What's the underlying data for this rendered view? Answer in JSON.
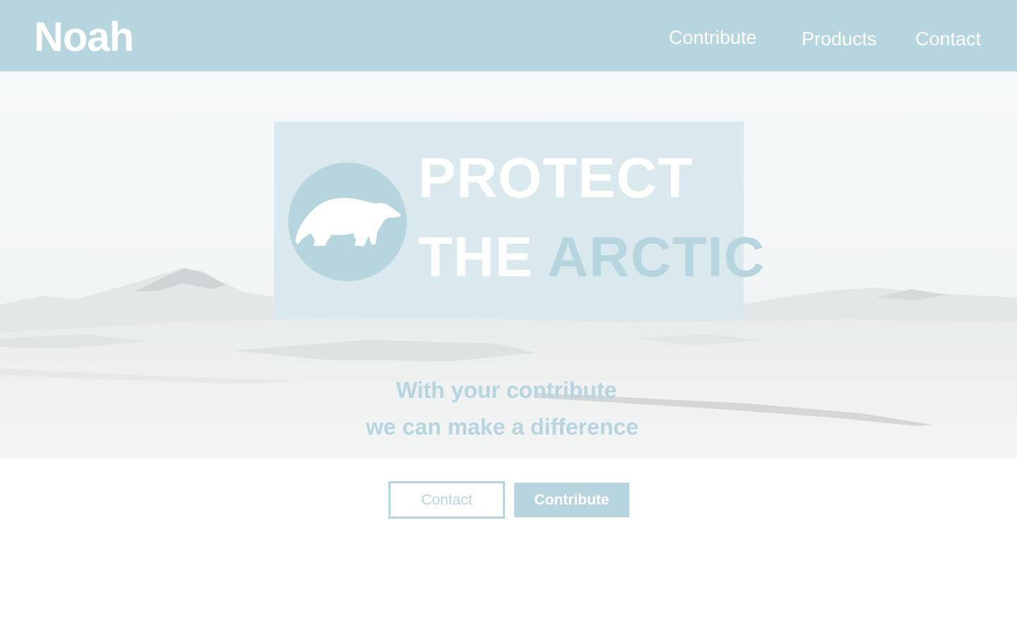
{
  "header": {
    "logo": "Noah",
    "nav": [
      {
        "label": "Contribute"
      },
      {
        "label": "Products"
      },
      {
        "label": "Contact"
      }
    ]
  },
  "hero": {
    "headline_line1": "PROTECT",
    "headline_line2_part1": "THE ",
    "headline_line2_part2": "ARCTIC",
    "logo_icon": "polar-bear-icon",
    "tagline_line1": "With your contribute",
    "tagline_line2": "we can make a difference"
  },
  "actions": {
    "contact_label": "Contact",
    "contribute_label": "Contribute"
  },
  "colors": {
    "accent": "#b7d5df",
    "card": "#dae9ed",
    "text_on_accent": "#ffffff",
    "page_background": "#ffffff"
  }
}
